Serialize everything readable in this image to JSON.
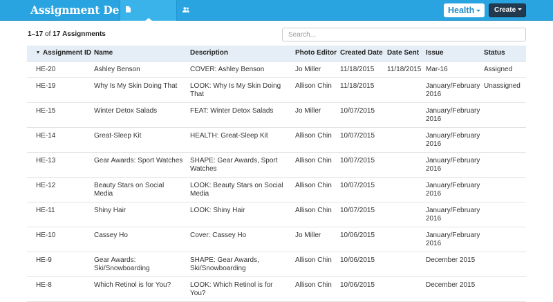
{
  "navbar": {
    "brand": "Assignment Desk",
    "tabs": [
      {
        "label": "Assignments",
        "icon": "document-icon",
        "active": true
      },
      {
        "label": "Vendors",
        "icon": "users-icon",
        "active": false
      }
    ],
    "publication": "Health",
    "create_label": "Create"
  },
  "toolbar": {
    "count_range": "1–17",
    "count_of": "of",
    "count_total": "17",
    "count_noun": "Assignments",
    "search_placeholder": "Search...",
    "search_value": ""
  },
  "table": {
    "columns": [
      "Assignment ID",
      "Name",
      "Description",
      "Photo Editor",
      "Created Date",
      "Date Sent",
      "Issue",
      "Status"
    ],
    "sorted_column": "Assignment ID",
    "rows": [
      {
        "id": "HE-20",
        "name": "Ashley Benson",
        "description": "COVER: Ashley Benson",
        "photo_editor": "Jo Miller",
        "created": "11/18/2015",
        "sent": "11/18/2015",
        "issue": "Mar-16",
        "status": "Assigned"
      },
      {
        "id": "HE-19",
        "name": "Why Is My Skin Doing That",
        "description": "LOOK: Why Is My Skin Doing That",
        "photo_editor": "Allison Chin",
        "created": "11/18/2015",
        "sent": "",
        "issue": "January/February 2016",
        "status": "Unassigned"
      },
      {
        "id": "HE-15",
        "name": "Winter Detox Salads",
        "description": "FEAT: Winter Detox Salads",
        "photo_editor": "Jo Miller",
        "created": "10/07/2015",
        "sent": "",
        "issue": "January/February 2016",
        "status": ""
      },
      {
        "id": "HE-14",
        "name": "Great-Sleep Kit",
        "description": "HEALTH: Great-Sleep Kit",
        "photo_editor": "Allison Chin",
        "created": "10/07/2015",
        "sent": "",
        "issue": "January/February 2016",
        "status": ""
      },
      {
        "id": "HE-13",
        "name": "Gear Awards: Sport Watches",
        "description": "SHAPE: Gear Awards, Sport Watches",
        "photo_editor": "Allison Chin",
        "created": "10/07/2015",
        "sent": "",
        "issue": "January/February 2016",
        "status": ""
      },
      {
        "id": "HE-12",
        "name": "Beauty Stars on Social Media",
        "description": "LOOK: Beauty Stars on Social Media",
        "photo_editor": "Allison Chin",
        "created": "10/07/2015",
        "sent": "",
        "issue": "January/February 2016",
        "status": ""
      },
      {
        "id": "HE-11",
        "name": "Shiny Hair",
        "description": "LOOK: Shiny Hair",
        "photo_editor": "Allison Chin",
        "created": "10/07/2015",
        "sent": "",
        "issue": "January/February 2016",
        "status": ""
      },
      {
        "id": "HE-10",
        "name": "Cassey Ho",
        "description": "Cover: Cassey Ho",
        "photo_editor": "Jo Miller",
        "created": "10/06/2015",
        "sent": "",
        "issue": "January/February 2016",
        "status": ""
      },
      {
        "id": "HE-9",
        "name": "Gear Awards: Ski/Snowboarding",
        "description": "SHAPE: Gear Awards, Ski/Snowboarding",
        "photo_editor": "Allison Chin",
        "created": "10/06/2015",
        "sent": "",
        "issue": "December 2015",
        "status": ""
      },
      {
        "id": "HE-8",
        "name": "Which Retinol is for You?",
        "description": "LOOK: Which Retinol is for You?",
        "photo_editor": "Allison Chin",
        "created": "10/06/2015",
        "sent": "",
        "issue": "December 2015",
        "status": ""
      }
    ]
  },
  "colors": {
    "navbar": "#2aa4e0",
    "create_button": "#23394f",
    "table_header": "#e5eef6",
    "publication_text": "#1f8cc5"
  }
}
